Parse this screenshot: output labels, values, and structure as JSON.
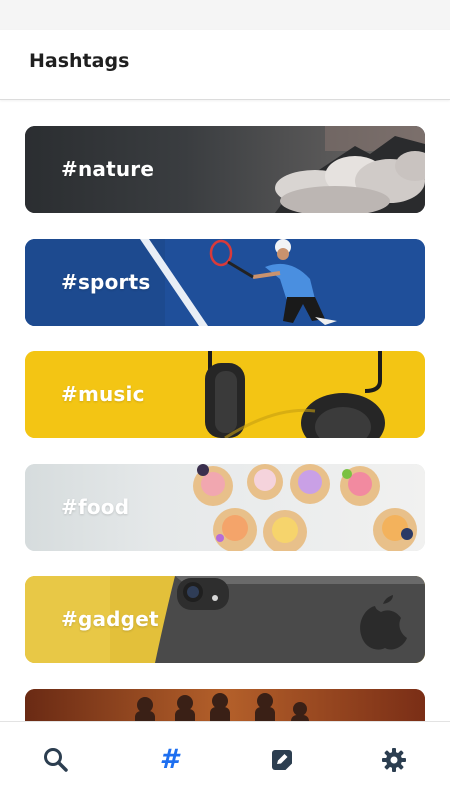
{
  "header": {
    "title": "Hashtags"
  },
  "cards": [
    {
      "label": "#nature"
    },
    {
      "label": "#sports"
    },
    {
      "label": "#music"
    },
    {
      "label": "#food"
    },
    {
      "label": "#gadget"
    },
    {
      "label": ""
    }
  ],
  "bottom_nav": {
    "items": [
      {
        "icon": "search-icon",
        "active": false
      },
      {
        "icon": "hashtag-icon",
        "glyph": "#",
        "active": true
      },
      {
        "icon": "edit-note-icon",
        "active": false
      },
      {
        "icon": "gear-icon",
        "active": false
      }
    ]
  },
  "colors": {
    "accent": "#1e6ff0",
    "nav_icon": "#2c3e50",
    "nature": "#2b2e31",
    "sports": "#1f4f9a",
    "music": "#f3c514",
    "food": "#d6dcdd",
    "gadget": "#e3c03a",
    "partial_card": "#8a3a1f"
  }
}
